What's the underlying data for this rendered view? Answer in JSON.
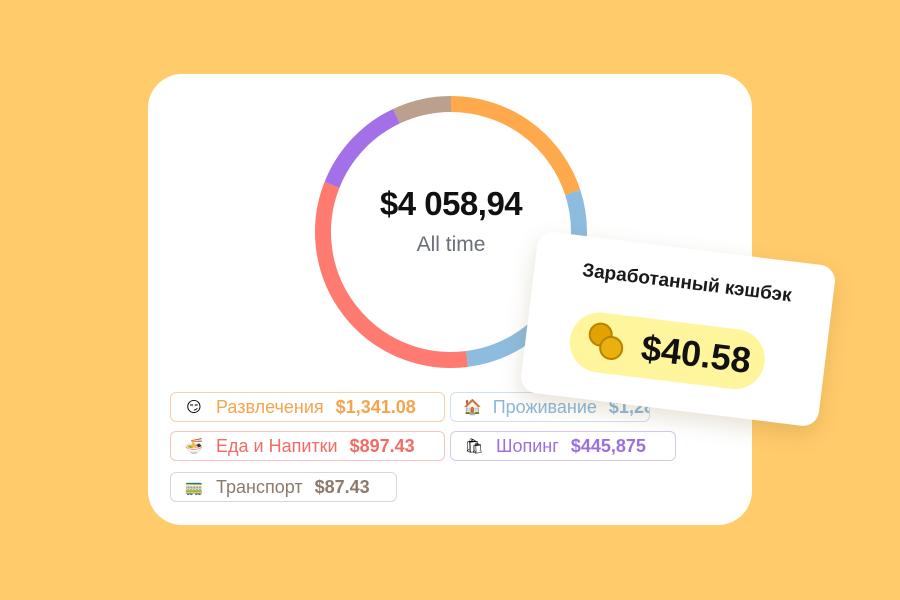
{
  "summary": {
    "total": "$4 058,94",
    "period": "All time"
  },
  "chart_data": {
    "type": "pie",
    "style": "donut",
    "slices": [
      {
        "color": "#FFA94D",
        "share": 0.2
      },
      {
        "color": "#8EBCDF",
        "share": 0.28
      },
      {
        "color": "#FF7B72",
        "share": 0.33
      },
      {
        "color": "#A370E8",
        "share": 0.12
      },
      {
        "color": "#BBA08D",
        "share": 0.07
      }
    ]
  },
  "categories": [
    {
      "emoji": "😏",
      "name": "Развлечения",
      "amount": "$1,341.08",
      "color": "#F5A44E",
      "border": "#F7D0A8"
    },
    {
      "emoji": "🏠",
      "name": "Проживание",
      "amount": "$1,286.65",
      "color": "#8BB8DC",
      "border": "#CFE0EE"
    },
    {
      "emoji": "🍜",
      "name": "Еда и Напитки",
      "amount": "$897.43",
      "color": "#F36B63",
      "border": "#F8C4C0"
    },
    {
      "emoji": "🛍",
      "name": "Шопинг",
      "amount": "$445,875",
      "color": "#9B6FE0",
      "border": "#D6C6F2"
    },
    {
      "emoji": "🚃",
      "name": "Транспорт",
      "amount": "$87.43",
      "color": "#8C7A6B",
      "border": "#DDD6CF"
    }
  ],
  "cashback": {
    "title": "Заработанный кэшбэк",
    "amount": "$40.58"
  },
  "colors": {
    "background": "#FFCB6B",
    "card": "#FFFFFF",
    "cashback_pill": "#FFF59D"
  }
}
